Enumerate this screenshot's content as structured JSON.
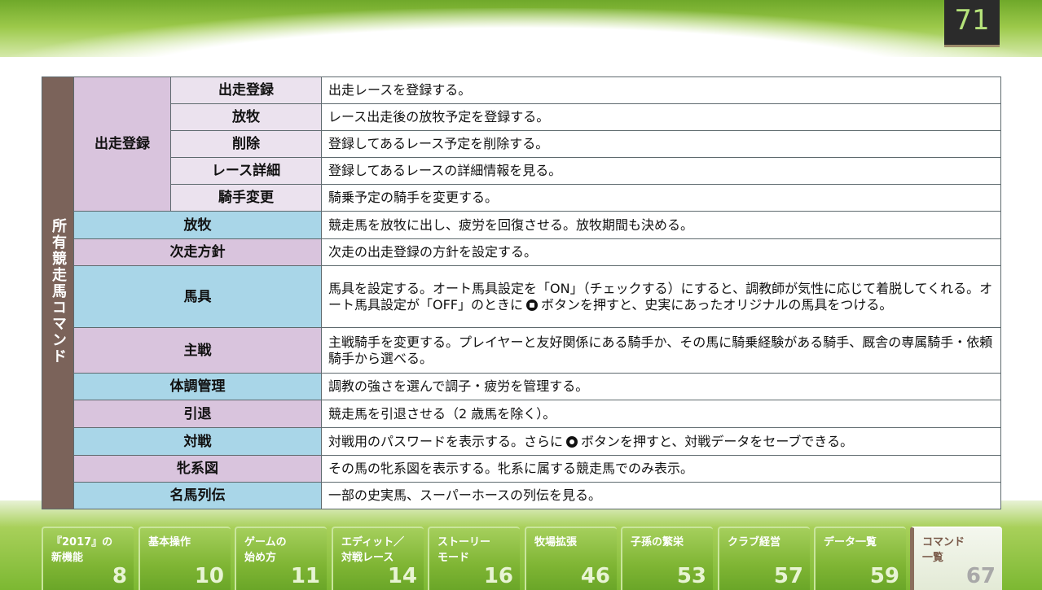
{
  "page_number": "71",
  "section_label": "所有競走馬コマンド",
  "group": {
    "label": "出走登録",
    "rows": [
      {
        "name": "出走登録",
        "desc": "出走レースを登録する。"
      },
      {
        "name": "放牧",
        "desc": "レース出走後の放牧予定を登録する。"
      },
      {
        "name": "削除",
        "desc": "登録してあるレース予定を削除する。"
      },
      {
        "name": "レース詳細",
        "desc": "登録してあるレースの詳細情報を見る。"
      },
      {
        "name": "騎手変更",
        "desc": "騎乗予定の騎手を変更する。"
      }
    ]
  },
  "commands": [
    {
      "name": "放牧",
      "desc": "競走馬を放牧に出し、疲労を回復させる。放牧期間も決める。",
      "color": "blue"
    },
    {
      "name": "次走方針",
      "desc": "次走の出走登録の方針を設定する。",
      "color": "pink"
    },
    {
      "name": "馬具",
      "desc_before": "馬具を設定する。オート馬具設定を「ON」（チェックする）にすると、調教師が気性に応じて着脱してくれる。オート馬具設定が「OFF」のときに",
      "desc_after": "ボタンを押すと、史実にあったオリジナルの馬具をつける。",
      "icon": "square-button-icon",
      "color": "blue"
    },
    {
      "name": "主戦",
      "desc": "主戦騎手を変更する。プレイヤーと友好関係にある騎手か、その馬に騎乗経験がある騎手、厩舎の専属騎手・依頼騎手から選べる。",
      "color": "pink"
    },
    {
      "name": "体調管理",
      "desc": "調教の強さを選んで調子・疲労を管理する。",
      "color": "blue"
    },
    {
      "name": "引退",
      "desc": "競走馬を引退させる（2 歳馬を除く）。",
      "color": "pink"
    },
    {
      "name": "対戦",
      "desc_before": "対戦用のパスワードを表示する。さらに",
      "desc_after": "ボタンを押すと、対戦データをセーブできる。",
      "icon": "circle-button-icon",
      "color": "blue"
    },
    {
      "name": "牝系図",
      "desc": "その馬の牝系図を表示する。牝系に属する競走馬でのみ表示。",
      "color": "pink"
    },
    {
      "name": "名馬列伝",
      "desc": "一部の史実馬、スーパーホースの列伝を見る。",
      "color": "blue"
    }
  ],
  "tabs": [
    {
      "label1": "『2017』の",
      "label2": "新機能",
      "num": "8"
    },
    {
      "label1": "基本操作",
      "label2": "",
      "num": "10"
    },
    {
      "label1": "ゲームの",
      "label2": "始め方",
      "num": "11"
    },
    {
      "label1": "エディット／",
      "label2": "対戦レース",
      "num": "14"
    },
    {
      "label1": "ストーリー",
      "label2": "モード",
      "num": "16"
    },
    {
      "label1": "牧場拡張",
      "label2": "",
      "num": "46"
    },
    {
      "label1": "子孫の繁栄",
      "label2": "",
      "num": "53"
    },
    {
      "label1": "クラブ経営",
      "label2": "",
      "num": "57"
    },
    {
      "label1": "データ一覧",
      "label2": "",
      "num": "59"
    },
    {
      "label1": "コマンド",
      "label2": "一覧",
      "num": "67",
      "active": true
    }
  ],
  "colors": {
    "side": "#7b635a",
    "pink": "#d9c4dd",
    "blue": "#a9d6e8",
    "accent_green": "#8dbf3a"
  }
}
